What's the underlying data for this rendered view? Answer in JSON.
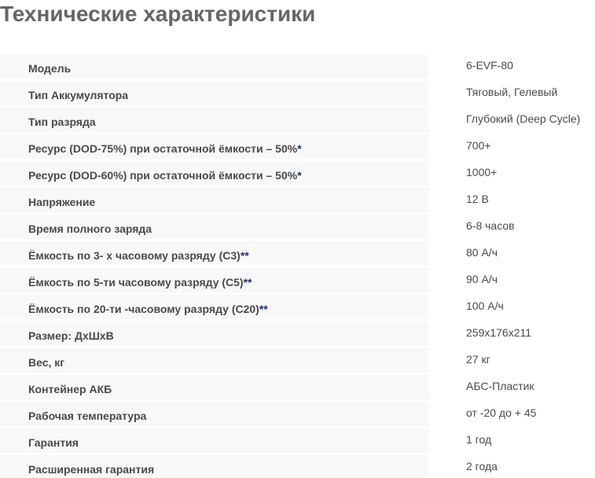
{
  "title": "Технические характеристики",
  "colors": {
    "title": "#666666",
    "label_bg": "#f8f8f8",
    "text": "#4a4a4a",
    "footnote_mark": "#1f2f7a"
  },
  "specs": [
    {
      "label": "Модель",
      "mark": "",
      "value": "6-EVF-80"
    },
    {
      "label": "Тип Аккумулятора",
      "mark": "",
      "value": "Тяговый, Гелевый"
    },
    {
      "label": "Тип разряда",
      "mark": "",
      "value": "Глубокий (Deep Cycle)"
    },
    {
      "label": "Ресурс (DOD-75%) при остаточной ёмкости – 50%",
      "mark": "*",
      "value": "700+"
    },
    {
      "label": "Ресурс (DOD-60%) при остаточной ёмкости – 50%",
      "mark": "*",
      "value": "1000+"
    },
    {
      "label": "Напряжение",
      "mark": "",
      "value": "12 В"
    },
    {
      "label": "Время полного заряда",
      "mark": "",
      "value": "6-8 часов"
    },
    {
      "label": "Ёмкость по 3- х часовому разряду (С3)",
      "mark": "**",
      "value": "80 А/ч"
    },
    {
      "label": "Ёмкость по 5-ти часовому разряду (С5)",
      "mark": "**",
      "value": "90 А/ч"
    },
    {
      "label": "Ёмкость по 20-ти -часовому разряду (С20)",
      "mark": "**",
      "value": "100 А/ч"
    },
    {
      "label": "Размер: ДхШхВ",
      "mark": "",
      "value": "259x176x211"
    },
    {
      "label": "Вес, кг",
      "mark": "",
      "value": "27 кг"
    },
    {
      "label": "Контейнер АКБ",
      "mark": "",
      "value": "АБС-Пластик"
    },
    {
      "label": "Рабочая температура",
      "mark": "",
      "value": "от -20 до + 45"
    },
    {
      "label": "Гарантия",
      "mark": "",
      "value": "1 год"
    },
    {
      "label": "Расширенная гарантия",
      "mark": "",
      "value": "2 года"
    }
  ]
}
